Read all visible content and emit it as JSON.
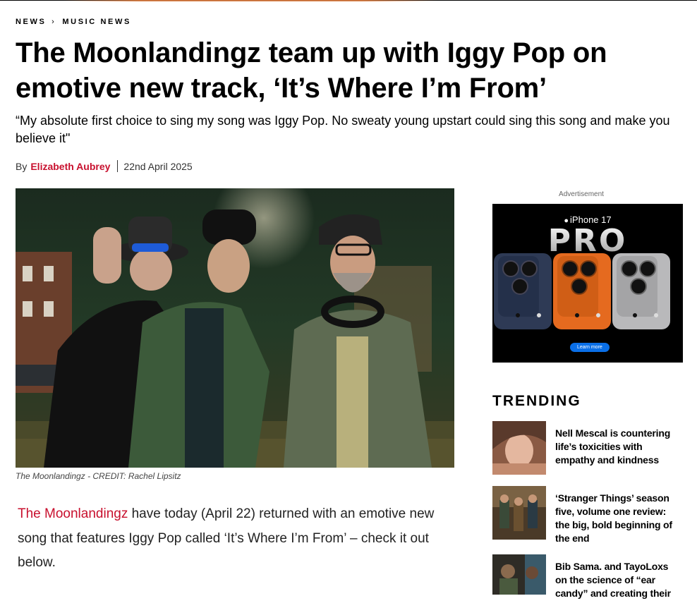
{
  "breadcrumb": {
    "items": [
      "NEWS",
      "MUSIC NEWS"
    ],
    "separator": "›"
  },
  "article": {
    "headline": "The Moonlandingz team up with Iggy Pop on emotive new track, ‘It’s Where I’m From’",
    "standfirst": "“My absolute first choice to sing my song was Iggy Pop. No sweaty young upstart could sing this song and make you believe it\"",
    "byline_prefix": "By",
    "author": "Elizabeth Aubrey",
    "date": "22nd April 2025",
    "image_caption": "The Moonlandingz - CREDIT: Rachel Lipsitz",
    "body_link": "The Moonlandingz",
    "body_text": " have today (April 22) returned with an emotive new song that features Iggy Pop called ‘It’s Where I’m From’ – check it out below."
  },
  "ad": {
    "label": "Advertisement",
    "brand": "iPhone 17",
    "headline": "PRO",
    "cta": "Learn more"
  },
  "trending": {
    "title": "TRENDING",
    "items": [
      {
        "title": "Nell Mescal is countering life’s toxicities with empathy and kindness"
      },
      {
        "title": "‘Stranger Things’ season five, volume one review: the big, bold beginning of the end"
      },
      {
        "title": "Bib Sama. and TayoLoxs on the science of “ear candy” and creating their"
      }
    ]
  },
  "colors": {
    "accent": "#c8102e",
    "text": "#000000",
    "ad_background": "#000000",
    "cta": "#0a6fe8"
  },
  "icons": {
    "apple_logo": "apple-icon"
  }
}
